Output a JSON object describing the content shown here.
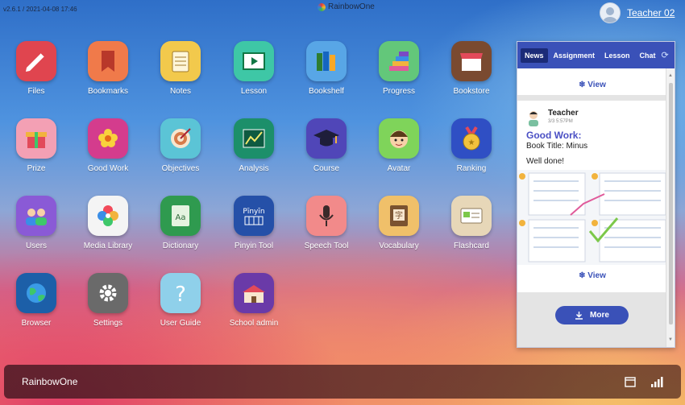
{
  "header": {
    "version": "v2.6.1 / 2021-04-08 17:46",
    "brand": "RainbowOne",
    "user_name": "Teacher 02"
  },
  "apps": [
    {
      "label": "Files",
      "icon": "pencil-icon",
      "color": "#e0454f"
    },
    {
      "label": "Bookmarks",
      "icon": "bookmark-icon",
      "color": "#f07a4a"
    },
    {
      "label": "Notes",
      "icon": "notepad-icon",
      "color": "#f2c94c"
    },
    {
      "label": "Lesson",
      "icon": "play-board-icon",
      "color": "#3ec7a6"
    },
    {
      "label": "Bookshelf",
      "icon": "books-icon",
      "color": "#58a6e6"
    },
    {
      "label": "Progress",
      "icon": "stairs-icon",
      "color": "#63c77a"
    },
    {
      "label": "Bookstore",
      "icon": "store-icon",
      "color": "#7a4a30"
    },
    {
      "label": "Prize",
      "icon": "gift-icon",
      "color": "#f3a0b4"
    },
    {
      "label": "Good Work",
      "icon": "flower-icon",
      "color": "#d43c8d"
    },
    {
      "label": "Objectives",
      "icon": "target-icon",
      "color": "#5bc4d6"
    },
    {
      "label": "Analysis",
      "icon": "chart-board-icon",
      "color": "#1c8f6a"
    },
    {
      "label": "Course",
      "icon": "graduation-cap-icon",
      "color": "#5046b8"
    },
    {
      "label": "Avatar",
      "icon": "face-icon",
      "color": "#7fd45a"
    },
    {
      "label": "Ranking",
      "icon": "medal-icon",
      "color": "#2f4fc4"
    },
    {
      "label": "Users",
      "icon": "users-icon",
      "color": "#8a5ad6"
    },
    {
      "label": "Media Library",
      "icon": "photos-icon",
      "color": "#f4f4f4"
    },
    {
      "label": "Dictionary",
      "icon": "dictionary-icon",
      "color": "#2f9a4f"
    },
    {
      "label": "Pinyin Tool",
      "icon": "pinyin-icon",
      "color": "#2550a8"
    },
    {
      "label": "Speech Tool",
      "icon": "microphone-icon",
      "color": "#f28a8a"
    },
    {
      "label": "Vocabulary",
      "icon": "vocabulary-book-icon",
      "color": "#f0c06a"
    },
    {
      "label": "Flashcard",
      "icon": "flashcard-icon",
      "color": "#e7d7b8"
    },
    {
      "label": "Browser",
      "icon": "globe-icon",
      "color": "#1c5fa8"
    },
    {
      "label": "Settings",
      "icon": "gear-icon",
      "color": "#6a6a6a"
    },
    {
      "label": "User Guide",
      "icon": "question-icon",
      "color": "#8fd0ea"
    },
    {
      "label": "School admin",
      "icon": "school-icon",
      "color": "#6a3aa8"
    }
  ],
  "panel": {
    "tabs": [
      "News",
      "Assignment",
      "Lesson",
      "Chat"
    ],
    "active_tab": "News",
    "view_label": "View",
    "post": {
      "author": "Teacher",
      "time": "3/3 5:57PM",
      "title": "Good Work:",
      "book_title": "Book Title:  Minus",
      "message": "Well done!"
    },
    "more_label": "More"
  },
  "taskbar": {
    "title": "RainbowOne"
  },
  "colors": {
    "accent": "#3a51b8",
    "good_work_title": "#4a4fc4"
  }
}
